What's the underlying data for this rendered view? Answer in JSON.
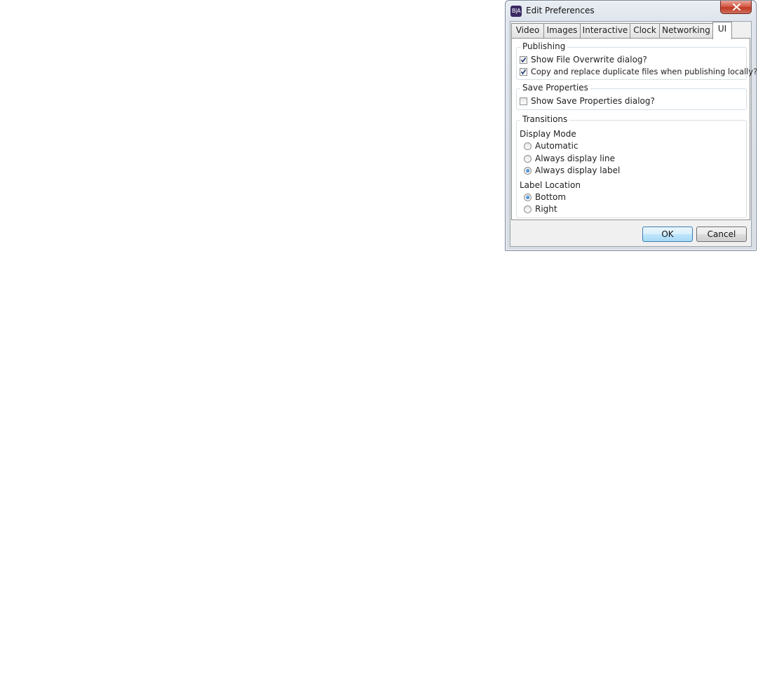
{
  "window": {
    "title": "Edit Preferences",
    "app_icon_text": "B|A",
    "close_icon": "close-icon"
  },
  "tabs": [
    {
      "label": "Video",
      "active": false
    },
    {
      "label": "Images",
      "active": false
    },
    {
      "label": "Interactive",
      "active": false
    },
    {
      "label": "Clock",
      "active": false
    },
    {
      "label": "Networking",
      "active": false
    },
    {
      "label": "UI",
      "active": true
    }
  ],
  "publishing": {
    "title": "Publishing",
    "show_file_overwrite": {
      "label": "Show File Overwrite dialog?",
      "checked": true
    },
    "copy_replace": {
      "label": "Copy and replace duplicate files when publishing locally?",
      "checked": true
    }
  },
  "save_properties": {
    "title": "Save Properties",
    "show_save_properties": {
      "label": "Show Save Properties dialog?",
      "checked": false
    }
  },
  "transitions": {
    "title": "Transitions",
    "display_mode": {
      "label": "Display Mode",
      "options": [
        {
          "label": "Automatic",
          "selected": false
        },
        {
          "label": "Always display line",
          "selected": false
        },
        {
          "label": "Always display label",
          "selected": true
        }
      ]
    },
    "label_location": {
      "label": "Label Location",
      "options": [
        {
          "label": "Bottom",
          "selected": true
        },
        {
          "label": "Right",
          "selected": false
        }
      ]
    }
  },
  "buttons": {
    "ok": "OK",
    "cancel": "Cancel"
  },
  "colors": {
    "default_button_border": "#3c7fb1",
    "close_button": "#c03a24",
    "app_icon": "#3b2a63"
  }
}
